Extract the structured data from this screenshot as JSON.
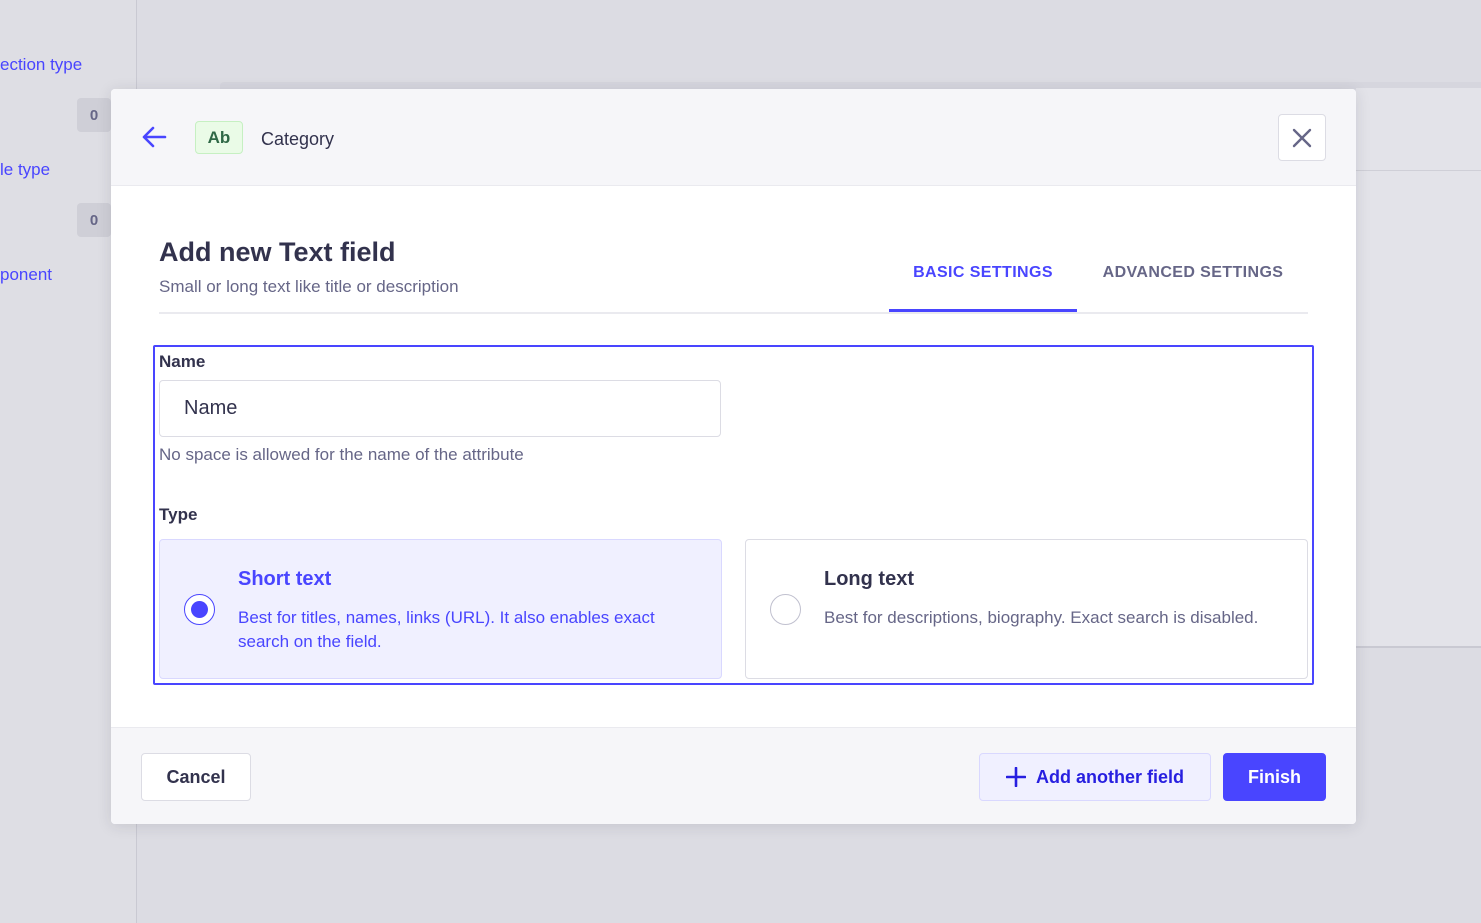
{
  "background": {
    "sidebar_links": [
      "ection type",
      "le type",
      "ponent"
    ],
    "sidebar_counts": [
      "0",
      "0"
    ]
  },
  "header": {
    "badge": "Ab",
    "title": "Category"
  },
  "modal": {
    "title": "Add new Text field",
    "subtitle": "Small or long text like title or description",
    "tabs": [
      {
        "label": "BASIC SETTINGS",
        "active": true
      },
      {
        "label": "ADVANCED SETTINGS",
        "active": false
      }
    ]
  },
  "form": {
    "name_label": "Name",
    "name_value": "Name",
    "name_hint": "No space is allowed for the name of the attribute",
    "type_label": "Type",
    "types": [
      {
        "title": "Short text",
        "description": "Best for titles, names, links (URL). It also enables exact search on the field.",
        "selected": true
      },
      {
        "title": "Long text",
        "description": "Best for descriptions, biography. Exact search is disabled.",
        "selected": false
      }
    ]
  },
  "footer": {
    "cancel_label": "Cancel",
    "add_label": "Add another field",
    "finish_label": "Finish"
  },
  "colors": {
    "primary": "#4945ff",
    "badge_green": "#2f6846"
  }
}
